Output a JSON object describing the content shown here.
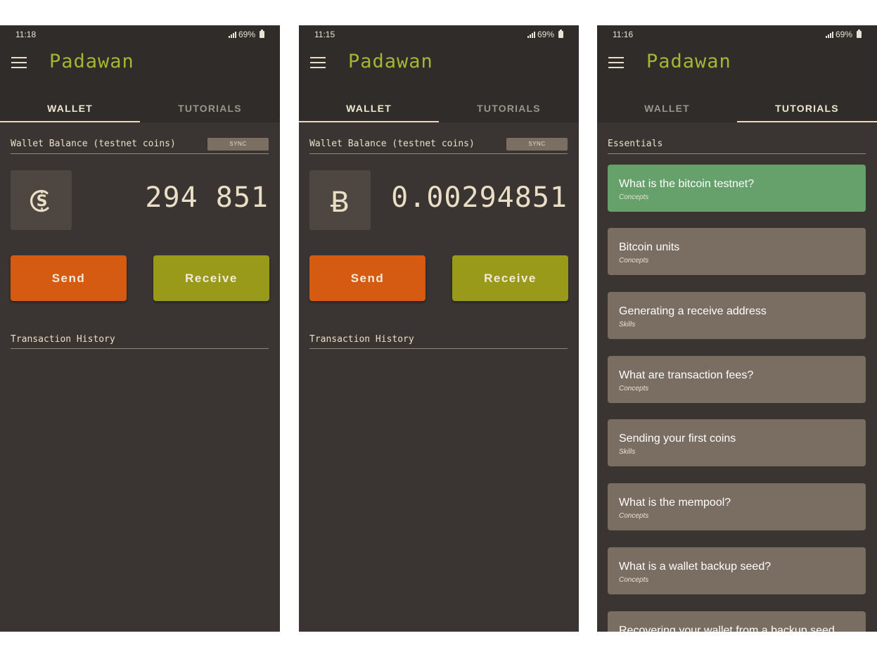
{
  "colors": {
    "screen_bg": "#3a3532",
    "appbar_bg": "#302c29",
    "title_color": "#a6b631",
    "send_bg": "#d55a12",
    "receive_bg": "#99991a",
    "card_bg": "#7a6e62",
    "card_highlight_bg": "#66a06a"
  },
  "app": {
    "title": "Padawan",
    "menu_icon": "hamburger-menu-icon"
  },
  "tabs": {
    "wallet": "WALLET",
    "tutorials": "TUTORIALS"
  },
  "wallet_screen": {
    "balance_label": "Wallet Balance (testnet coins)",
    "sync_label": "SYNC",
    "send_label": "Send",
    "receive_label": "Receive",
    "history_label": "Transaction History"
  },
  "screens": [
    {
      "time": "11:18",
      "battery": "69%",
      "active_tab": "wallet",
      "unit_icon": "satoshi-coin-icon",
      "balance": "294 851"
    },
    {
      "time": "11:15",
      "battery": "69%",
      "active_tab": "wallet",
      "unit_icon": "bitcoin-b-icon",
      "unit_glyph": "Ƀ",
      "balance": "0.00294851"
    },
    {
      "time": "11:16",
      "battery": "69%",
      "active_tab": "tutorials",
      "section": "Essentials",
      "tutorials": [
        {
          "title": "What is the bitcoin testnet?",
          "category": "Concepts",
          "highlighted": true
        },
        {
          "title": "Bitcoin units",
          "category": "Concepts"
        },
        {
          "title": "Generating a receive address",
          "category": "Skills"
        },
        {
          "title": "What are transaction fees?",
          "category": "Concepts"
        },
        {
          "title": "Sending your first coins",
          "category": "Skills"
        },
        {
          "title": "What is the mempool?",
          "category": "Concepts"
        },
        {
          "title": "What is a wallet backup seed?",
          "category": "Concepts"
        },
        {
          "title": "Recovering your wallet from a backup seed",
          "category": ""
        }
      ]
    }
  ]
}
